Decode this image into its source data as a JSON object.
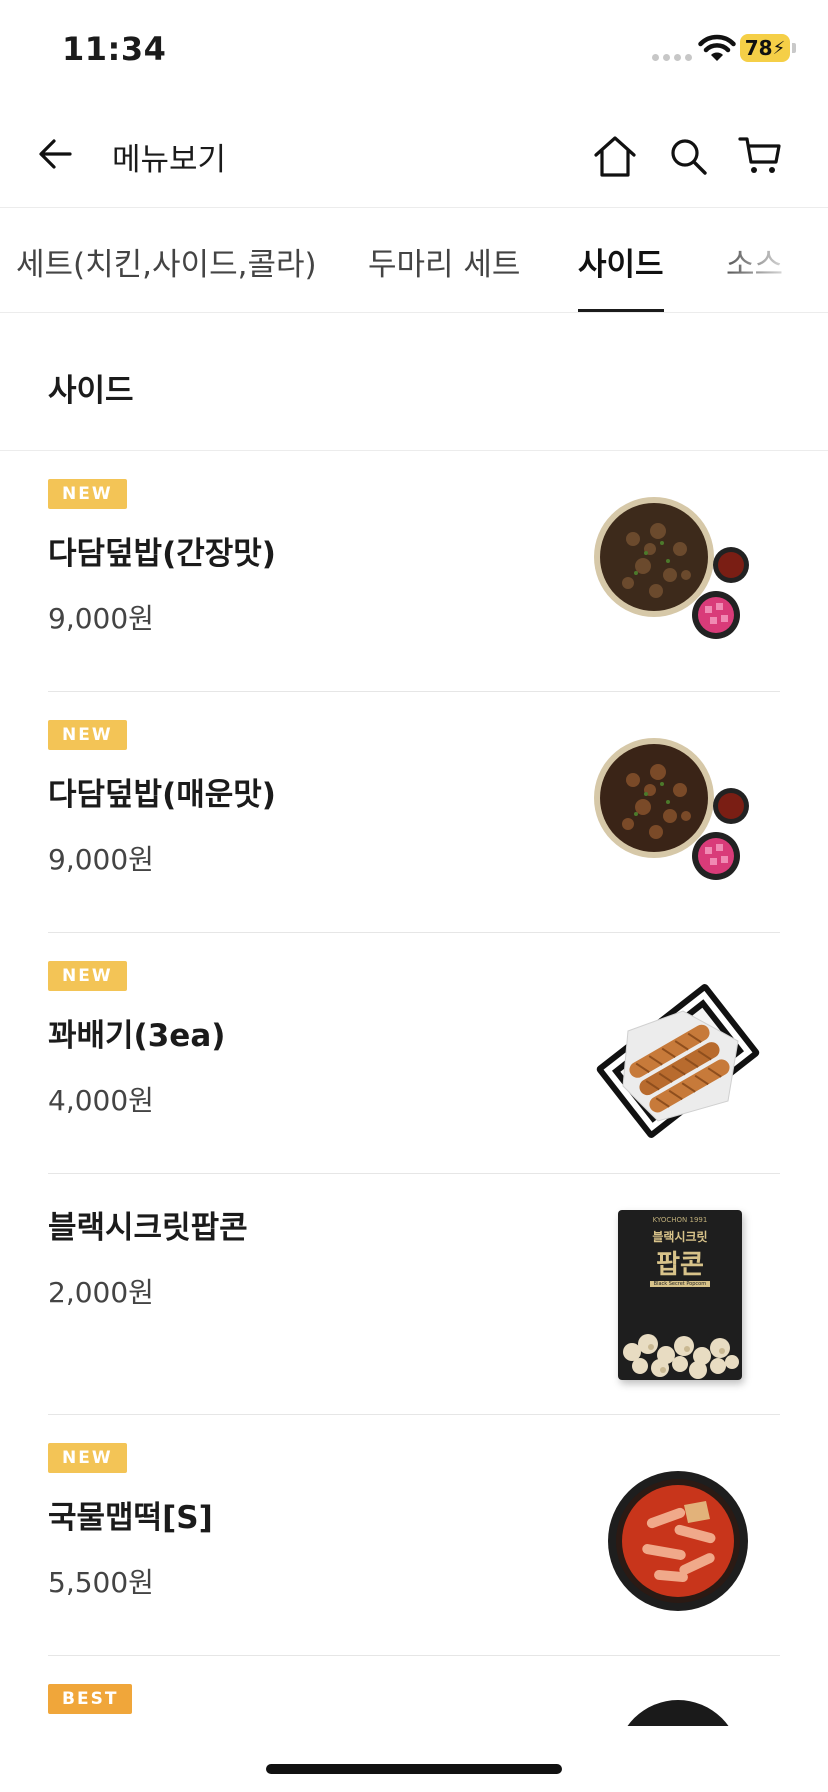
{
  "status": {
    "time": "11:34",
    "battery": "78"
  },
  "header": {
    "title": "메뉴보기"
  },
  "tabs": [
    {
      "label": "세트(치킨,사이드,콜라)",
      "active": false
    },
    {
      "label": "두마리 세트",
      "active": false
    },
    {
      "label": "사이드",
      "active": true
    },
    {
      "label": "소스",
      "active": false
    }
  ],
  "section": {
    "title": "사이드"
  },
  "items": [
    {
      "badge": "NEW",
      "name": "다담덮밥(간장맛)",
      "price": "9,000원",
      "image": "rice-bowl-icon"
    },
    {
      "badge": "NEW",
      "name": "다담덮밥(매운맛)",
      "price": "9,000원",
      "image": "rice-bowl-icon"
    },
    {
      "badge": "NEW",
      "name": "꽈배기(3ea)",
      "price": "4,000원",
      "image": "twisted-donut-icon"
    },
    {
      "badge": "",
      "name": "블랙시크릿팝콘",
      "price": "2,000원",
      "image": "popcorn-bag-icon"
    },
    {
      "badge": "NEW",
      "name": "국물맵떡[S]",
      "price": "5,500원",
      "image": "tteokbokki-icon"
    },
    {
      "badge": "BEST",
      "name": "",
      "price": "",
      "image": "dish-icon"
    }
  ],
  "popcorn_bag": {
    "brand": "KYOCHON 1991",
    "line1": "블랙시크릿",
    "line2": "팝콘",
    "subtitle": "Black Secret Popcorn"
  },
  "colors": {
    "badge_new": "#f3c456",
    "badge_best": "#f0a63a",
    "battery": "#f5cf47"
  }
}
